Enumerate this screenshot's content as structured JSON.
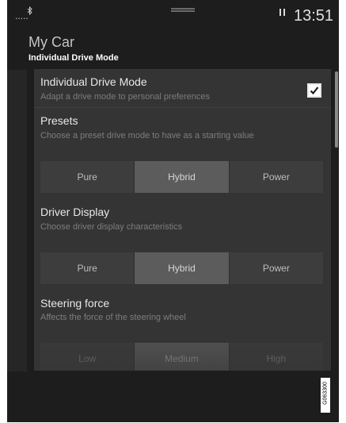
{
  "status_bar": {
    "signal": ".....",
    "bluetooth_icon": "bluetooth-icon",
    "media_icon": "pause-icon",
    "time": "13:51"
  },
  "header": {
    "title": "My Car",
    "subtitle": "Individual Drive Mode"
  },
  "settings": {
    "individual": {
      "title": "Individual Drive Mode",
      "description": "Adapt a drive mode to personal preferences",
      "checked": true
    },
    "presets": {
      "title": "Presets",
      "description": "Choose a preset drive mode to have as a starting value",
      "options": [
        "Pure",
        "Hybrid",
        "Power"
      ],
      "selected": "Hybrid"
    },
    "driver_display": {
      "title": "Driver Display",
      "description": "Choose driver display characteristics",
      "options": [
        "Pure",
        "Hybrid",
        "Power"
      ],
      "selected": "Hybrid"
    },
    "steering": {
      "title": "Steering force",
      "description": "Affects the force of the steering wheel",
      "options": [
        "Low",
        "Medium",
        "High"
      ],
      "selected": "Medium"
    }
  },
  "watermark": "G063300"
}
